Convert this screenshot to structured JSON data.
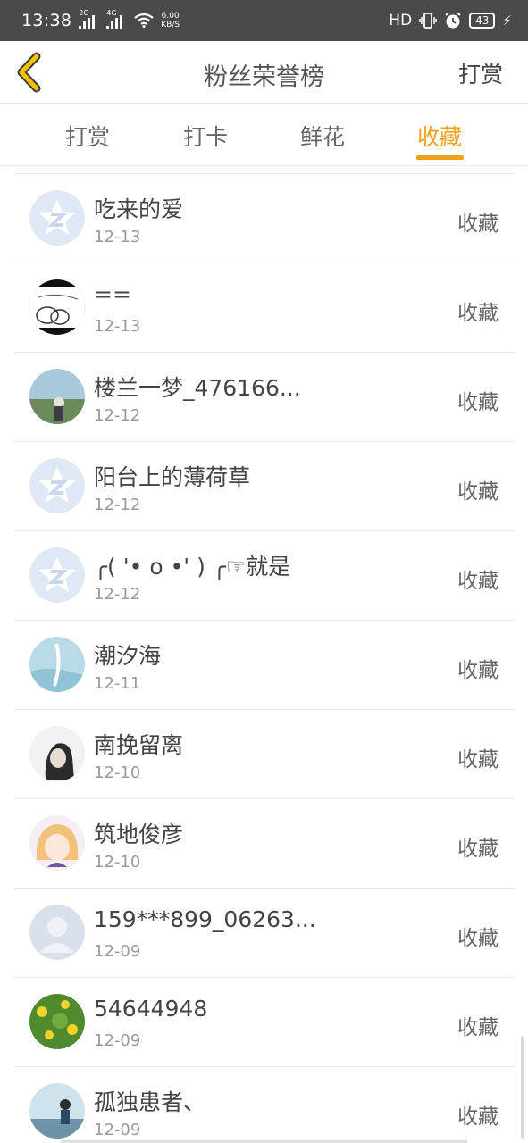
{
  "status_bar": {
    "time": "13:38",
    "net1": "2G",
    "net2": "4G",
    "speed_value": "6.00",
    "speed_unit": "KB/S",
    "hd": "HD",
    "battery": "43"
  },
  "header": {
    "title": "粉丝荣誉榜",
    "action": "打赏"
  },
  "tabs": [
    {
      "label": "打赏"
    },
    {
      "label": "打卡"
    },
    {
      "label": "鲜花"
    },
    {
      "label": "收藏"
    }
  ],
  "active_tab": 3,
  "accent_color": "#f0a21b",
  "list": [
    {
      "name": "吃来的爱",
      "date": "12-13",
      "action": "收藏",
      "avatar": "default-star-avatar"
    },
    {
      "name": "==",
      "date": "12-13",
      "action": "收藏",
      "avatar": "sketch-avatar"
    },
    {
      "name": "楼兰一梦_476166...",
      "date": "12-12",
      "action": "收藏",
      "avatar": "photo-avatar"
    },
    {
      "name": "阳台上的薄荷草",
      "date": "12-12",
      "action": "收藏",
      "avatar": "default-star-avatar"
    },
    {
      "name": "╭( '• o •' ) ╭☞就是",
      "date": "12-12",
      "action": "收藏",
      "avatar": "default-star-avatar"
    },
    {
      "name": "潮汐海",
      "date": "12-11",
      "action": "收藏",
      "avatar": "photo-avatar"
    },
    {
      "name": "南挽留离",
      "date": "12-10",
      "action": "收藏",
      "avatar": "photo-avatar"
    },
    {
      "name": "筑地俊彦",
      "date": "12-10",
      "action": "收藏",
      "avatar": "anime-avatar"
    },
    {
      "name": "159***899_06263...",
      "date": "12-09",
      "action": "收藏",
      "avatar": "default-person-avatar"
    },
    {
      "name": "54644948",
      "date": "12-09",
      "action": "收藏",
      "avatar": "photo-avatar"
    },
    {
      "name": "孤独患者、",
      "date": "12-09",
      "action": "收藏",
      "avatar": "photo-avatar"
    }
  ]
}
